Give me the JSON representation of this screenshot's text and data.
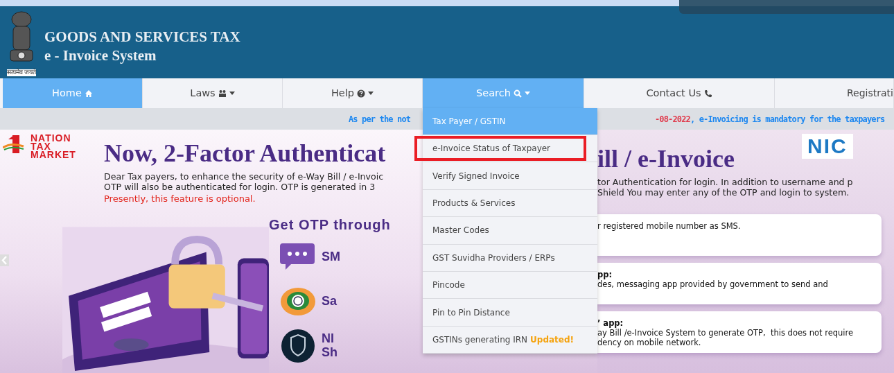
{
  "header": {
    "motto": "सत्यमेव जयते",
    "title": "GOODS AND SERVICES TAX",
    "subtitle": "e - Invoice System"
  },
  "nav": [
    {
      "label": "Home",
      "caret": false,
      "selected": true
    },
    {
      "label": "Laws",
      "caret": true,
      "selected": false
    },
    {
      "label": "Help",
      "caret": true,
      "selected": false
    },
    {
      "label": "Search",
      "caret": true,
      "selected": true
    },
    {
      "label": "Contact Us",
      "caret": false,
      "selected": false
    },
    {
      "label": "Registrati",
      "caret": false,
      "selected": false
    }
  ],
  "search_menu": [
    {
      "label": "Tax Payer / GSTIN",
      "selected": true,
      "highlighted": false
    },
    {
      "label": "e-Invoice Status of Taxpayer",
      "selected": false,
      "highlighted": true
    },
    {
      "label": "Verify Signed Invoice",
      "selected": false,
      "highlighted": false
    },
    {
      "label": "Products & Services",
      "selected": false,
      "highlighted": false
    },
    {
      "label": "Master Codes",
      "selected": false,
      "highlighted": false
    },
    {
      "label": "GST Suvidha Providers / ERPs",
      "selected": false,
      "highlighted": false
    },
    {
      "label": "Pincode",
      "selected": false,
      "highlighted": false
    },
    {
      "label": "Pin to Pin Distance",
      "selected": false,
      "highlighted": false
    },
    {
      "label": "GSTINs generating IRN",
      "selected": false,
      "highlighted": false,
      "badge": "Updated!"
    }
  ],
  "notice": {
    "left": "As per the not",
    "date": "-08-2022",
    "right": ", e-Invoicing is mandatory for the taxpayers"
  },
  "banner": {
    "logo": [
      "NATION",
      "TAX",
      "MARKET"
    ],
    "nic_logo": "NIC",
    "headline_left": "Now, 2-Factor Authenticat",
    "headline_right": "ill / e-Invoice",
    "intro_left": [
      "Dear Tax payers, to enhance the security of e-Way Bill / e-Invoic",
      "OTP will also be authenticated for login. OTP is generated in 3"
    ],
    "intro_right": [
      "tor Authentication for login. In addition to username and p",
      "Shield  You may enter any of the OTP and login to system."
    ],
    "note": "Presently, this feature is optional.",
    "otp_heading": "Get OTP through",
    "methods": [
      {
        "label": "SM",
        "text": "r registered mobile number as SMS."
      },
      {
        "label": "Sa",
        "heading": "pp:",
        "text": "des, messaging app provided by government to send and"
      },
      {
        "label": "NI\nSh",
        "heading": "’ app:",
        "text": "ay Bill /e-Invoice System to generate OTP,  this does not require\ndency on mobile network."
      }
    ]
  }
}
